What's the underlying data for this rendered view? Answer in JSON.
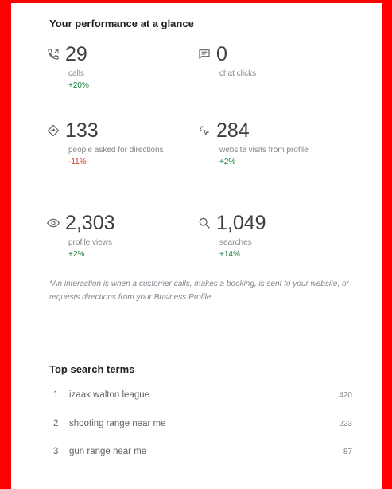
{
  "performance": {
    "title": "Your performance at a glance",
    "metrics": [
      {
        "icon": "phone-icon",
        "value": "29",
        "label": "calls",
        "change": "+20%",
        "direction": "up"
      },
      {
        "icon": "chat-icon",
        "value": "0",
        "label": "chat clicks",
        "change": "",
        "direction": "none"
      },
      {
        "icon": "directions-icon",
        "value": "133",
        "label": "people asked for directions",
        "change": "-11%",
        "direction": "down"
      },
      {
        "icon": "click-icon",
        "value": "284",
        "label": "website visits from profile",
        "change": "+2%",
        "direction": "up"
      },
      {
        "icon": "eye-icon",
        "value": "2,303",
        "label": "profile views",
        "change": "+2%",
        "direction": "up"
      },
      {
        "icon": "search-icon",
        "value": "1,049",
        "label": "searches",
        "change": "+14%",
        "direction": "up"
      }
    ],
    "footnote": "*An interaction is when a customer calls, makes a booking, is sent to your website, or requests directions from your Business Profile."
  },
  "search_terms": {
    "title": "Top search terms",
    "items": [
      {
        "rank": "1",
        "term": "izaak walton league",
        "count": "420"
      },
      {
        "rank": "2",
        "term": "shooting range near me",
        "count": "223"
      },
      {
        "rank": "3",
        "term": "gun range near me",
        "count": "87"
      }
    ]
  },
  "colors": {
    "positive": "#188038",
    "negative": "#d93025",
    "frame": "#ff0000"
  }
}
